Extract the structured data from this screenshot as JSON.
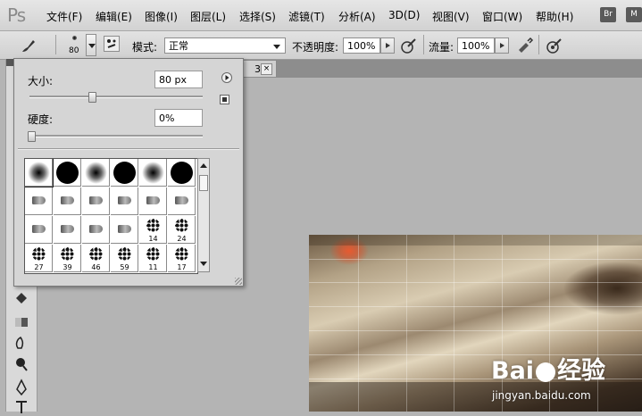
{
  "app": {
    "logo_text": "Ps"
  },
  "menu": {
    "items": [
      "文件(F)",
      "编辑(E)",
      "图像(I)",
      "图层(L)",
      "选择(S)",
      "滤镜(T)",
      "分析(A)",
      "3D(D)",
      "视图(V)",
      "窗口(W)",
      "帮助(H)"
    ],
    "bridge_btn": "Br",
    "mini_btn": "M"
  },
  "options": {
    "brush_size_value": "80",
    "mode_label": "模式:",
    "mode_value": "正常",
    "opacity_label": "不透明度:",
    "opacity_value": "100%",
    "flow_label": "流量:",
    "flow_value": "100%"
  },
  "document": {
    "tab_fragment": "3) *",
    "close_glyph": "×"
  },
  "brush_popup": {
    "size_label": "大小:",
    "size_value": "80 px",
    "size_fraction": 0.36,
    "hardness_label": "硬度:",
    "hardness_value": "0%",
    "hardness_fraction": 0.0,
    "presets": [
      {
        "kind": "soft",
        "num": ""
      },
      {
        "kind": "hard",
        "num": ""
      },
      {
        "kind": "soft",
        "num": ""
      },
      {
        "kind": "hard",
        "num": ""
      },
      {
        "kind": "soft",
        "num": ""
      },
      {
        "kind": "hard",
        "num": ""
      },
      {
        "kind": "tool",
        "num": ""
      },
      {
        "kind": "tool",
        "num": ""
      },
      {
        "kind": "tool",
        "num": ""
      },
      {
        "kind": "tool",
        "num": ""
      },
      {
        "kind": "tool",
        "num": ""
      },
      {
        "kind": "tool",
        "num": ""
      },
      {
        "kind": "tool",
        "num": ""
      },
      {
        "kind": "tool",
        "num": ""
      },
      {
        "kind": "tool",
        "num": ""
      },
      {
        "kind": "tool",
        "num": ""
      },
      {
        "kind": "splat",
        "num": "14"
      },
      {
        "kind": "splat",
        "num": "24"
      },
      {
        "kind": "splat",
        "num": "27"
      },
      {
        "kind": "splat",
        "num": "39"
      },
      {
        "kind": "splat",
        "num": "46"
      },
      {
        "kind": "splat",
        "num": "59"
      },
      {
        "kind": "splat",
        "num": "11"
      },
      {
        "kind": "splat",
        "num": "17"
      }
    ]
  },
  "watermark": {
    "logo_text": "Bai",
    "logo_text_cn": "经验",
    "url": "jingyan.baidu.com"
  },
  "colors": {
    "menubar_bg": "#d8d8d8",
    "workspace_bg": "#b4b4b4",
    "popup_bg": "#d5d5d5"
  }
}
